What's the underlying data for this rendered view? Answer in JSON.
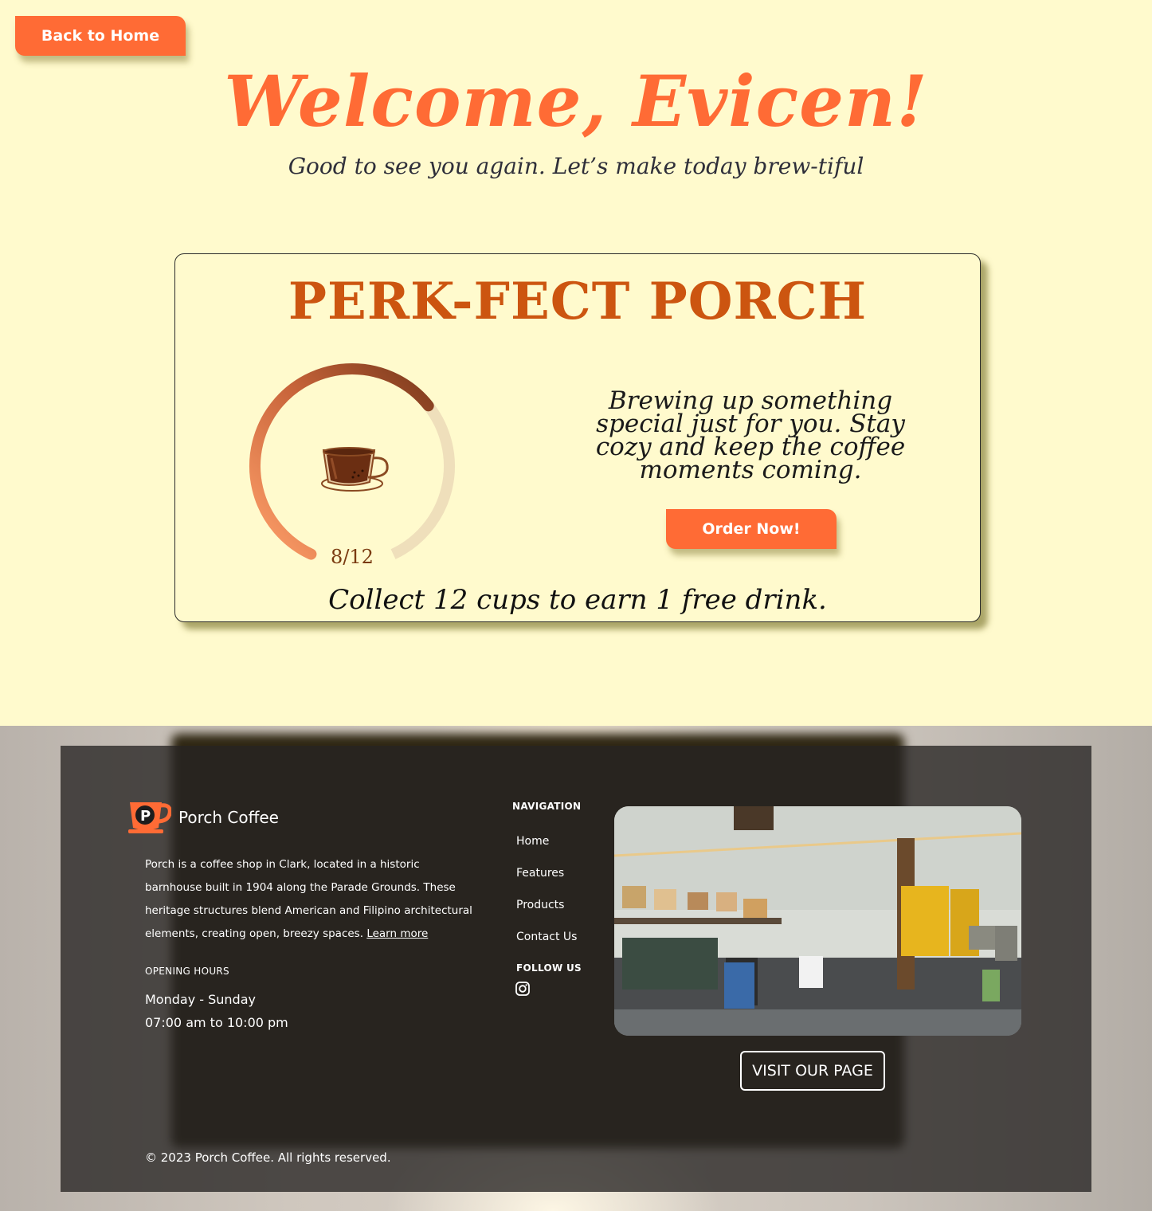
{
  "header": {
    "back_label": "Back to Home",
    "welcome": "Welcome, Evicen!",
    "subtitle": "Good to see you again. Let’s make today brew-tiful"
  },
  "card": {
    "title": "PERK-FECT PORCH",
    "progress": {
      "current": 8,
      "total": 12,
      "label": "8/12"
    },
    "promo_text": "Brewing up something special just for you. Stay cozy and keep the coffee moments coming.",
    "order_label": "Order Now!",
    "collect_text": "Collect 12 cups to earn 1 free drink."
  },
  "footer": {
    "brand_name": "Porch Coffee",
    "about_text": "Porch is a coffee shop in Clark, located in a historic barnhouse built in 1904 along the Parade Grounds. These heritage structures blend American and Filipino architectural elements, creating open, breezy spaces.",
    "learn_more": "Learn more",
    "hours_label": "OPENING HOURS",
    "hours_days": "Monday - Sunday",
    "hours_time": "07:00 am to 10:00 pm",
    "nav_label": "NAVIGATION",
    "nav_items": [
      "Home",
      "Features",
      "Products",
      "Contact Us"
    ],
    "follow_label": "FOLLOW US",
    "visit_label": "VISIT OUR PAGE",
    "copyright": "© 2023 Porch Coffee. All rights reserved."
  },
  "colors": {
    "accent": "#ff6b35",
    "title_orange": "#cc5510",
    "background": "#fffacd",
    "progress_dark": "#7b3a1c",
    "progress_light": "#ffa06a",
    "progress_track": "#efdfbb"
  },
  "icons": {
    "cup": "coffee-cup-icon",
    "social": "instagram-icon",
    "logo": "porch-logo-icon"
  }
}
